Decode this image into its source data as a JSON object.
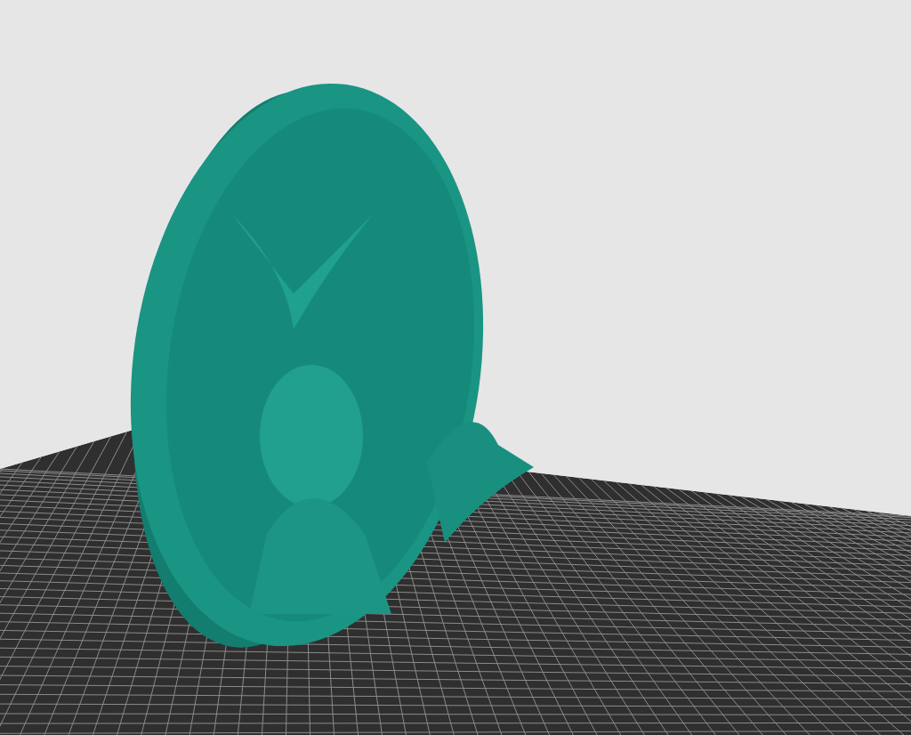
{
  "viewport": {
    "build_plate_grid": true,
    "model_shown": true
  }
}
